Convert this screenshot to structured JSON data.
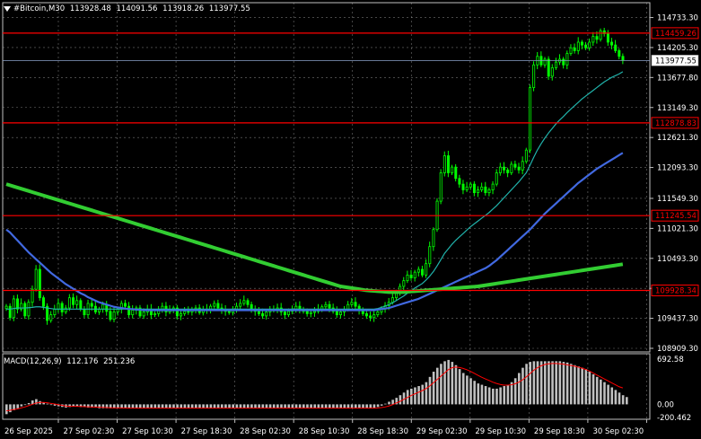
{
  "header": {
    "symbol": "#Bitcoin,M30",
    "open": "113928.48",
    "high": "114091.56",
    "low": "113918.26",
    "close": "113977.55"
  },
  "macd_header": {
    "name": "MACD(12,26,9)",
    "main": "112.176",
    "signal": "251.236"
  },
  "colors": {
    "background": "#000000",
    "grid": "#c0c0c0",
    "candle": "#00ff00",
    "level_line": "#ff0000",
    "ma_fast": "#20b2aa",
    "ma_mid": "#4169e1",
    "ma_slow": "#32cd32",
    "macd_hist": "#c0c0c0",
    "macd_signal": "#ff0000",
    "price_box": "#ffffff"
  },
  "chart_data": {
    "type": "candlestick",
    "instrument": "#Bitcoin",
    "timeframe": "M30",
    "ylim": [
      108909.3,
      114900.0
    ],
    "price_ticks": [
      "114733.30",
      "114205.30",
      "113677.80",
      "113149.30",
      "112621.30",
      "112093.30",
      "111549.30",
      "111021.30",
      "110493.30",
      "109965.30",
      "109437.30",
      "108909.30"
    ],
    "current_price": "113977.55",
    "levels": [
      {
        "value": 114459.26,
        "label": "114459.26"
      },
      {
        "value": 112878.83,
        "label": "112878.83"
      },
      {
        "value": 111245.54,
        "label": "111245.54"
      },
      {
        "value": 109928.34,
        "label": "109928.34"
      }
    ],
    "time_labels": [
      "26 Sep 2025",
      "27 Sep 02:30",
      "27 Sep 10:30",
      "27 Sep 18:30",
      "28 Sep 02:30",
      "28 Sep 10:30",
      "28 Sep 18:30",
      "29 Sep 02:30",
      "29 Sep 10:30",
      "29 Sep 18:30",
      "30 Sep 02:30"
    ],
    "close_series": [
      109650,
      109450,
      109780,
      109600,
      109700,
      109480,
      109720,
      109950,
      110300,
      109800,
      109650,
      109400,
      109500,
      109600,
      109700,
      109550,
      109620,
      109800,
      109680,
      109750,
      109600,
      109500,
      109700,
      109650,
      109550,
      109600,
      109680,
      109560,
      109420,
      109550,
      109600,
      109700,
      109650,
      109500,
      109580,
      109620,
      109480,
      109550,
      109600,
      109500,
      109520,
      109600,
      109650,
      109550,
      109580,
      109620,
      109480,
      109520,
      109560,
      109550,
      109600,
      109620,
      109540,
      109580,
      109600,
      109650,
      109700,
      109620,
      109580,
      109560,
      109540,
      109600,
      109650,
      109700,
      109750,
      109680,
      109600,
      109560,
      109520,
      109480,
      109550,
      109600,
      109580,
      109620,
      109550,
      109500,
      109560,
      109600,
      109650,
      109600,
      109560,
      109520,
      109540,
      109560,
      109600,
      109640,
      109680,
      109620,
      109560,
      109500,
      109550,
      109600,
      109680,
      109720,
      109650,
      109580,
      109520,
      109480,
      109450,
      109500,
      109550,
      109600,
      109660,
      109720,
      109800,
      109900,
      110000,
      110100,
      110200,
      110150,
      110250,
      110300,
      110200,
      110400,
      110700,
      111000,
      111500,
      112000,
      112300,
      112000,
      112100,
      111900,
      111800,
      111700,
      111750,
      111800,
      111650,
      111700,
      111750,
      111650,
      111700,
      111800,
      112000,
      112100,
      112050,
      112000,
      112150,
      112100,
      112050,
      112200,
      112400,
      113500,
      113900,
      114050,
      113900,
      114000,
      113700,
      113850,
      113950,
      114000,
      113900,
      114100,
      114200,
      114150,
      114300,
      114250,
      114200,
      114300,
      114400,
      114350,
      114500,
      114450,
      114300,
      114250,
      114150,
      114050,
      113977.55
    ],
    "ma_fast": [
      109600,
      109600,
      109610,
      109620,
      109620,
      109620,
      109625,
      109630,
      109640,
      109640,
      109630,
      109620,
      109610,
      109600,
      109600,
      109600,
      109600,
      109600,
      109600,
      109600,
      109600,
      109600,
      109600,
      109600,
      109600,
      109600,
      109600,
      109600,
      109600,
      109600,
      109600,
      109600,
      109600,
      109600,
      109600,
      109600,
      109600,
      109600,
      109600,
      109600,
      109600,
      109600,
      109600,
      109600,
      109600,
      109600,
      109600,
      109600,
      109600,
      109600,
      109600,
      109600,
      109600,
      109600,
      109600,
      109600,
      109600,
      109600,
      109600,
      109600,
      109600,
      109600,
      109600,
      109600,
      109600,
      109600,
      109600,
      109600,
      109600,
      109600,
      109600,
      109600,
      109600,
      109600,
      109600,
      109600,
      109600,
      109600,
      109600,
      109600,
      109600,
      109600,
      109600,
      109600,
      109600,
      109600,
      109600,
      109600,
      109600,
      109600,
      109600,
      109600,
      109600,
      109600,
      109600,
      109600,
      109600,
      109600,
      109600,
      109600,
      109610,
      109630,
      109650,
      109680,
      109710,
      109750,
      109790,
      109830,
      109880,
      109920,
      109970,
      110010,
      110050,
      110110,
      110180,
      110260,
      110360,
      110470,
      110580,
      110660,
      110740,
      110810,
      110870,
      110930,
      110990,
      111050,
      111100,
      111150,
      111200,
      111250,
      111300,
      111360,
      111420,
      111490,
      111560,
      111630,
      111700,
      111770,
      111840,
      111920,
      112000,
      112130,
      112270,
      112400,
      112510,
      112610,
      112700,
      112780,
      112860,
      112930,
      112990,
      113060,
      113120,
      113180,
      113240,
      113300,
      113350,
      113400,
      113450,
      113500,
      113550,
      113600,
      113640,
      113680,
      113710,
      113740,
      113780
    ],
    "ma_mid": [
      111000,
      110950,
      110880,
      110810,
      110740,
      110670,
      110600,
      110540,
      110480,
      110420,
      110360,
      110300,
      110240,
      110190,
      110140,
      110090,
      110040,
      110000,
      109960,
      109920,
      109880,
      109850,
      109810,
      109780,
      109750,
      109720,
      109700,
      109680,
      109660,
      109640,
      109630,
      109620,
      109610,
      109600,
      109600,
      109590,
      109590,
      109580,
      109580,
      109580,
      109580,
      109580,
      109580,
      109580,
      109580,
      109580,
      109580,
      109580,
      109580,
      109580,
      109580,
      109580,
      109580,
      109580,
      109580,
      109580,
      109580,
      109580,
      109580,
      109580,
      109580,
      109580,
      109580,
      109580,
      109580,
      109580,
      109580,
      109580,
      109580,
      109580,
      109580,
      109580,
      109580,
      109580,
      109580,
      109580,
      109580,
      109580,
      109580,
      109580,
      109580,
      109580,
      109580,
      109580,
      109580,
      109580,
      109580,
      109580,
      109580,
      109580,
      109580,
      109580,
      109580,
      109580,
      109580,
      109580,
      109580,
      109580,
      109580,
      109580,
      109590,
      109600,
      109610,
      109620,
      109640,
      109660,
      109680,
      109700,
      109720,
      109740,
      109760,
      109780,
      109810,
      109840,
      109870,
      109900,
      109930,
      109960,
      109990,
      110020,
      110050,
      110080,
      110110,
      110140,
      110170,
      110200,
      110230,
      110260,
      110290,
      110320,
      110360,
      110410,
      110460,
      110520,
      110580,
      110640,
      110700,
      110760,
      110820,
      110880,
      110940,
      111000,
      111070,
      111140,
      111210,
      111280,
      111340,
      111400,
      111460,
      111520,
      111580,
      111640,
      111700,
      111760,
      111820,
      111870,
      111920,
      111970,
      112020,
      112070,
      112110,
      112150,
      112190,
      112230,
      112270,
      112310,
      112350
    ],
    "ma_slow": [
      111800,
      111780,
      111760,
      111740,
      111720,
      111700,
      111680,
      111660,
      111640,
      111620,
      111600,
      111580,
      111560,
      111540,
      111520,
      111500,
      111480,
      111460,
      111440,
      111420,
      111400,
      111380,
      111360,
      111340,
      111320,
      111300,
      111280,
      111260,
      111240,
      111220,
      111200,
      111180,
      111160,
      111140,
      111120,
      111100,
      111080,
      111060,
      111040,
      111020,
      111000,
      110980,
      110960,
      110940,
      110920,
      110900,
      110880,
      110860,
      110840,
      110820,
      110800,
      110780,
      110760,
      110740,
      110720,
      110700,
      110680,
      110660,
      110640,
      110620,
      110600,
      110580,
      110560,
      110540,
      110520,
      110500,
      110480,
      110460,
      110440,
      110420,
      110400,
      110380,
      110360,
      110340,
      110320,
      110300,
      110280,
      110260,
      110240,
      110220,
      110200,
      110180,
      110160,
      110140,
      110120,
      110100,
      110080,
      110060,
      110040,
      110020,
      110000,
      109990,
      109980,
      109970,
      109960,
      109950,
      109940,
      109930,
      109925,
      109920,
      109915,
      109910,
      109905,
      109900,
      109900,
      109900,
      109900,
      109900,
      109905,
      109910,
      109915,
      109920,
      109925,
      109930,
      109935,
      109940,
      109945,
      109950,
      109955,
      109960,
      109965,
      109970,
      109975,
      109980,
      109985,
      109990,
      109995,
      110000,
      110010,
      110020,
      110030,
      110040,
      110050,
      110060,
      110070,
      110080,
      110090,
      110100,
      110110,
      110120,
      110130,
      110140,
      110150,
      110160,
      110170,
      110180,
      110190,
      110200,
      110210,
      110220,
      110230,
      110240,
      110250,
      110260,
      110270,
      110280,
      110290,
      110300,
      110310,
      110320,
      110330,
      110340,
      110350,
      110360,
      110370,
      110380,
      110390
    ],
    "macd": {
      "ylim": [
        -200.462,
        692.58
      ],
      "ticks": [
        "692.58",
        "0.00",
        "-200.462"
      ],
      "histogram": [
        -150,
        -120,
        -90,
        -60,
        -30,
        -10,
        20,
        60,
        80,
        50,
        30,
        10,
        -10,
        -20,
        -30,
        -40,
        -50,
        -40,
        -30,
        -30,
        -40,
        -40,
        -50,
        -50,
        -50,
        -60,
        -60,
        -60,
        -60,
        -60,
        -60,
        -60,
        -60,
        -60,
        -60,
        -60,
        -60,
        -60,
        -60,
        -60,
        -60,
        -60,
        -60,
        -60,
        -60,
        -60,
        -60,
        -60,
        -60,
        -60,
        -60,
        -60,
        -60,
        -60,
        -60,
        -60,
        -60,
        -60,
        -60,
        -60,
        -60,
        -60,
        -60,
        -60,
        -60,
        -60,
        -60,
        -60,
        -60,
        -60,
        -60,
        -60,
        -60,
        -60,
        -60,
        -60,
        -60,
        -60,
        -60,
        -60,
        -60,
        -60,
        -60,
        -60,
        -60,
        -60,
        -60,
        -60,
        -60,
        -60,
        -60,
        -60,
        -60,
        -60,
        -60,
        -60,
        -60,
        -60,
        -60,
        -60,
        -40,
        -20,
        10,
        40,
        70,
        100,
        140,
        180,
        220,
        240,
        260,
        280,
        300,
        340,
        420,
        500,
        560,
        620,
        660,
        680,
        650,
        600,
        540,
        480,
        440,
        400,
        360,
        320,
        300,
        280,
        260,
        240,
        240,
        260,
        280,
        300,
        340,
        400,
        480,
        560,
        620,
        650,
        660,
        660,
        660,
        660,
        660,
        660,
        660,
        660,
        650,
        640,
        620,
        600,
        580,
        560,
        540,
        500,
        460,
        420,
        380,
        340,
        300,
        260,
        220,
        180,
        140,
        112
      ],
      "signal": [
        -100,
        -90,
        -80,
        -70,
        -55,
        -40,
        -20,
        0,
        20,
        30,
        30,
        25,
        15,
        5,
        -5,
        -15,
        -25,
        -30,
        -30,
        -30,
        -32,
        -35,
        -38,
        -40,
        -42,
        -45,
        -48,
        -50,
        -52,
        -54,
        -55,
        -56,
        -57,
        -58,
        -58,
        -58,
        -58,
        -58,
        -58,
        -58,
        -58,
        -58,
        -58,
        -58,
        -58,
        -58,
        -58,
        -58,
        -58,
        -58,
        -58,
        -58,
        -58,
        -58,
        -58,
        -58,
        -58,
        -58,
        -58,
        -58,
        -58,
        -58,
        -58,
        -58,
        -58,
        -58,
        -58,
        -58,
        -58,
        -58,
        -58,
        -58,
        -58,
        -58,
        -58,
        -58,
        -58,
        -58,
        -58,
        -58,
        -58,
        -58,
        -58,
        -58,
        -58,
        -58,
        -58,
        -58,
        -58,
        -58,
        -58,
        -58,
        -58,
        -58,
        -58,
        -58,
        -58,
        -58,
        -58,
        -58,
        -55,
        -50,
        -40,
        -25,
        -5,
        20,
        45,
        75,
        105,
        135,
        160,
        185,
        210,
        240,
        280,
        330,
        380,
        430,
        480,
        530,
        560,
        570,
        565,
        550,
        530,
        505,
        475,
        445,
        415,
        390,
        365,
        340,
        320,
        305,
        295,
        295,
        300,
        315,
        340,
        375,
        420,
        470,
        520,
        560,
        590,
        610,
        620,
        625,
        625,
        620,
        615,
        605,
        595,
        585,
        570,
        555,
        535,
        510,
        480,
        450,
        420,
        390,
        360,
        330,
        300,
        270,
        251
      ]
    }
  }
}
